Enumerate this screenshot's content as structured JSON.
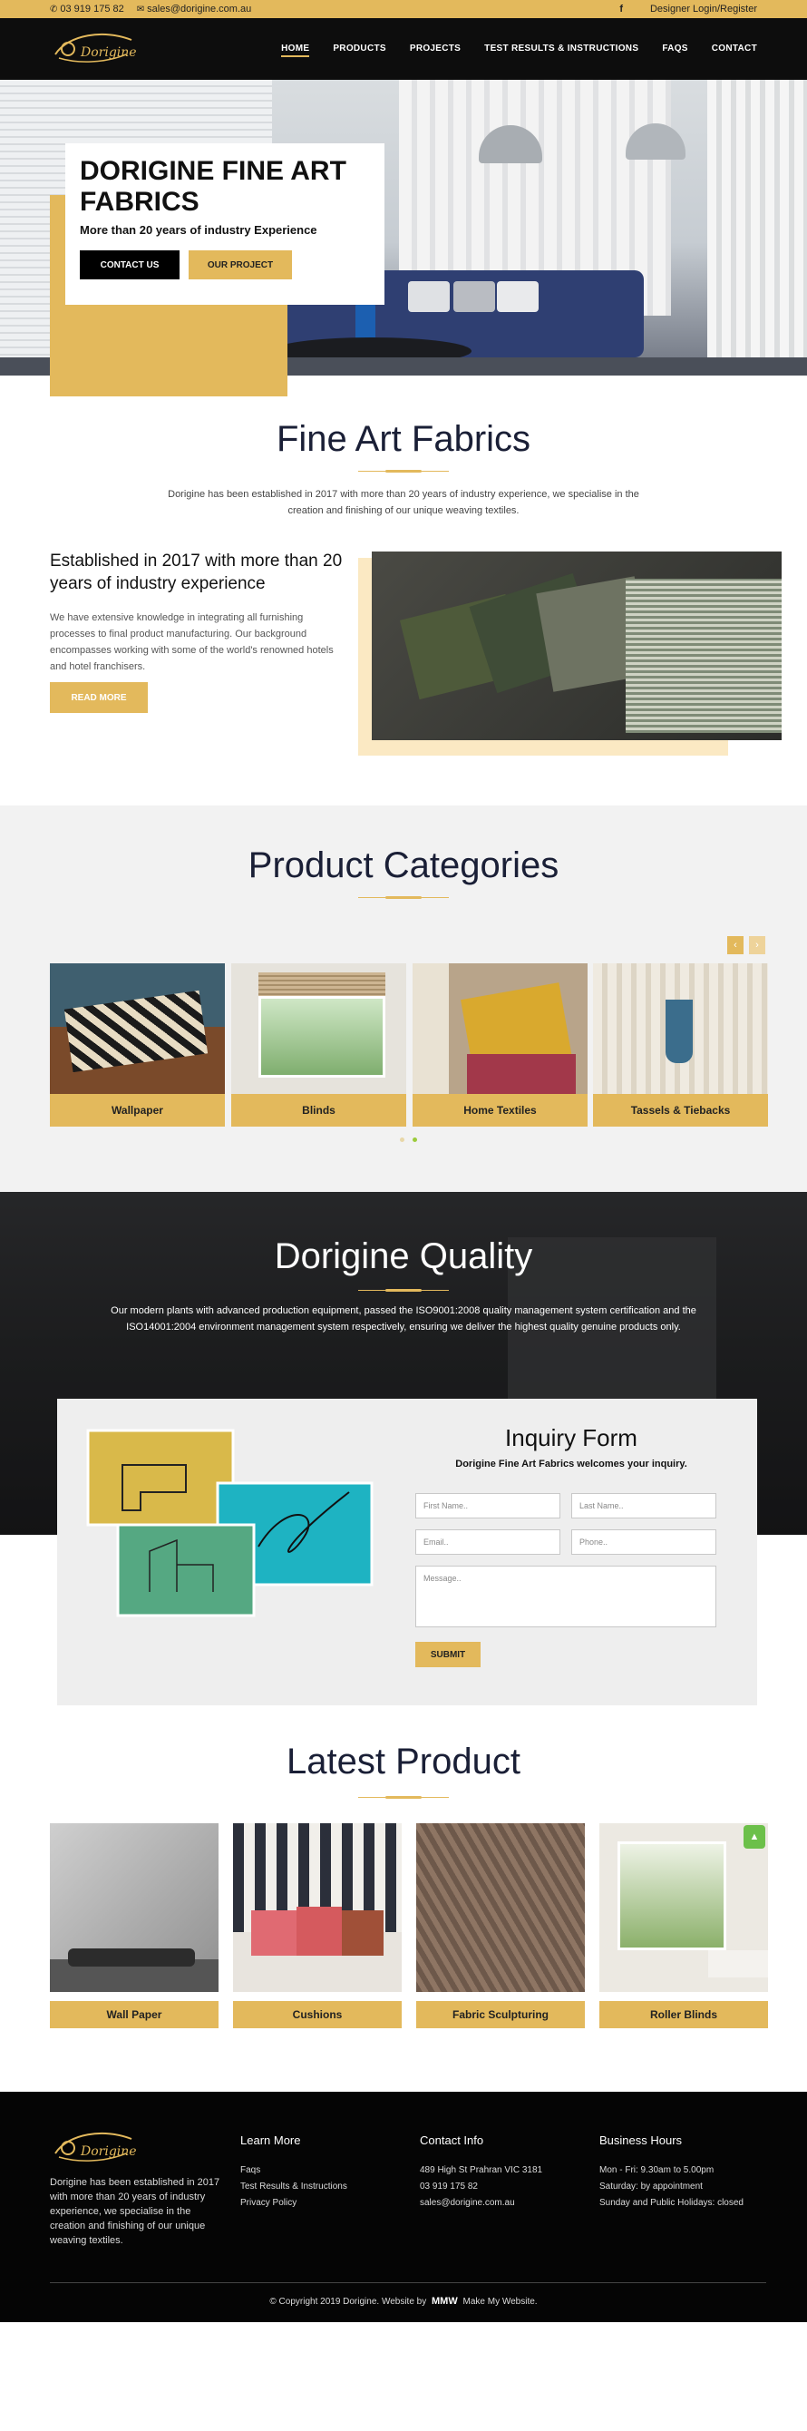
{
  "topbar": {
    "phone": "03 919 175 82",
    "email": "sales@dorigine.com.au",
    "social_icon": "facebook-icon",
    "login": "Designer Login/Register"
  },
  "nav": {
    "logo_text": "Dorigine",
    "items": [
      "HOME",
      "PRODUCTS",
      "PROJECTS",
      "TEST RESULTS & INSTRUCTIONS",
      "FAQS",
      "CONTACT"
    ]
  },
  "hero": {
    "title": "DORIGINE FINE ART FABRICS",
    "subtitle": "More than 20 years of industry Experience",
    "contact_btn": "CONTACT US",
    "project_btn": "OUR PROJECT"
  },
  "fine_art": {
    "title": "Fine Art Fabrics",
    "intro": "Dorigine has been established in 2017 with more than 20 years of industry experience, we specialise in the creation and finishing of our unique weaving textiles.",
    "est_title": "Established in 2017 with more than 20 years of industry experience",
    "est_text": "We have extensive knowledge in integrating all furnishing processes to final product manufacturing. Our background encompasses working with some of the world's renowned hotels and hotel franchisers.",
    "read_more": "READ MORE"
  },
  "categories": {
    "title": "Product Categories",
    "prev_icon": "chevron-left-icon",
    "next_icon": "chevron-right-icon",
    "items": [
      "Wallpaper",
      "Blinds",
      "Home Textiles",
      "Tassels & Tiebacks"
    ]
  },
  "quality": {
    "title": "Dorigine Quality",
    "text": "Our modern plants with advanced production equipment, passed the ISO9001:2008 quality management system certification and the ISO14001:2004 environment management system respectively, ensuring we deliver the highest quality genuine products only."
  },
  "inquiry": {
    "title": "Inquiry Form",
    "subtitle": "Dorigine Fine Art Fabrics welcomes your inquiry.",
    "first_name": "First Name..",
    "last_name": "Last Name..",
    "email": "Email..",
    "phone": "Phone..",
    "message": "Message..",
    "submit": "SUBMIT"
  },
  "latest": {
    "title": "Latest Product",
    "items": [
      "Wall Paper",
      "Cushions",
      "Fabric Sculpturing",
      "Roller Blinds"
    ]
  },
  "footer": {
    "about": "Dorigine has been established in 2017 with more than 20 years of industry experience, we specialise in the creation and finishing of our unique weaving textiles.",
    "learn_more": {
      "heading": "Learn More",
      "links": [
        "Faqs",
        "Test Results & Instructions",
        "Privacy Policy"
      ]
    },
    "contact": {
      "heading": "Contact Info",
      "lines": [
        "489 High St Prahran VIC 3181",
        "03 919 175 82",
        "sales@dorigine.com.au"
      ]
    },
    "hours": {
      "heading": "Business Hours",
      "lines": [
        "Mon - Fri: 9.30am to 5.00pm",
        "Saturday: by appointment",
        "Sunday and Public Holidays: closed"
      ]
    },
    "copyright": "© Copyright 2019 Dorigine. Website by",
    "copyright_mark": "MMW",
    "copyright_end": "Make My Website."
  },
  "colors": {
    "gold": "#e3b95c",
    "dark": "#0d0d0d",
    "navy_text": "#1a1f36"
  }
}
